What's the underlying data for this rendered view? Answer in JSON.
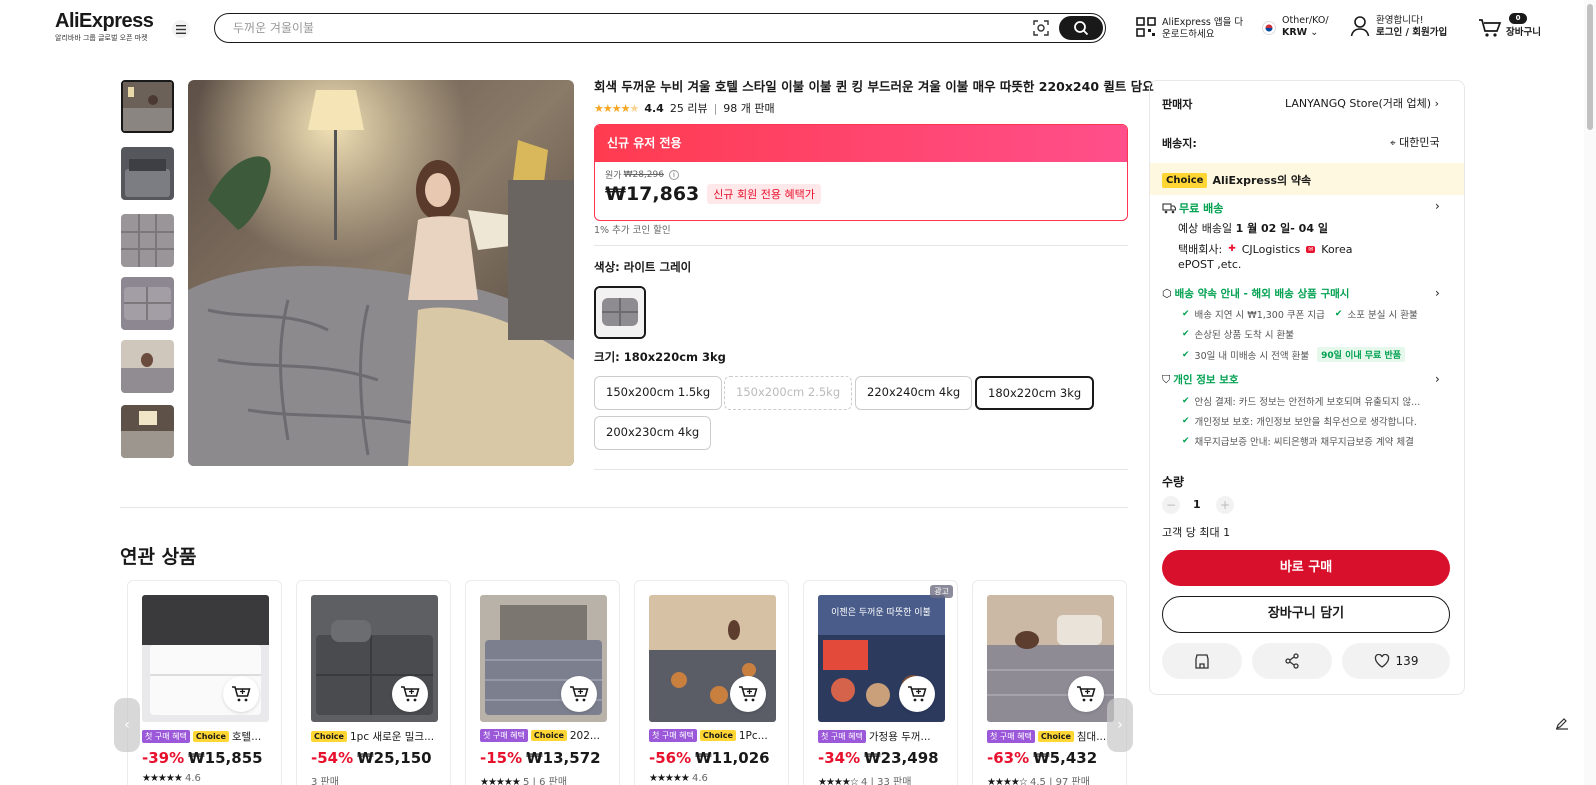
{
  "header": {
    "logo": "AliExpress",
    "logo_sub": "알리바바 그룹 글로벌 오픈 마켓",
    "search_placeholder": "두꺼운 겨울이불",
    "app_line1": "AliExpress 앱을 다",
    "app_line2": "운로드하세요",
    "region_line1": "Other/KO/",
    "region_line2": "KRW",
    "account_line1": "환영합니다!",
    "account_line2": "로그인 / 회원가입",
    "cart_count": "0",
    "cart_label": "장바구니"
  },
  "product": {
    "title": "회색 두꺼운 누비 겨울 호텔 스타일 이불 이불 퀸 킹 부드러운 겨울 이불 매우 따뜻한 220x240 퀼트 담요",
    "rating": "4.4",
    "reviews": "25 리뷰",
    "sold": "98 개 판매",
    "promo_header": "신규 유저 전용",
    "original_price_label": "원가",
    "original_price": "₩28,296",
    "price": "₩17,863",
    "promo_badge": "신규 회원 전용 혜택가",
    "coin_note": "1% 추가 코인 할인",
    "color_label": "색상: 라이트 그레이",
    "size_label": "크기: 180x220cm 3kg",
    "sizes": [
      {
        "label": "150x200cm 1.5kg",
        "state": "normal"
      },
      {
        "label": "150x200cm 2.5kg",
        "state": "disabled"
      },
      {
        "label": "220x240cm 4kg",
        "state": "normal"
      },
      {
        "label": "180x220cm 3kg",
        "state": "selected"
      },
      {
        "label": "200x230cm 4kg",
        "state": "normal"
      }
    ]
  },
  "panel": {
    "seller_label": "판매자",
    "seller_name": "LANYANGQ Store(거래 업체)",
    "ship_to_label": "배송지:",
    "ship_to": "대한민국",
    "choice_tag": "Choice",
    "choice_promise": "AliExpress의 약속",
    "free_shipping": "무료 배송",
    "delivery_prefix": "예상 배송일 ",
    "delivery_date": "1 월 02 일- 04 일",
    "carrier_label": "택배회사:",
    "carrier1": "CJLogistics",
    "carrier2": "Korea",
    "carrier3": "ePOST ,etc.",
    "promise_title": "배송 약속 안내 - 해외 배송 상품 구매시",
    "promise_items": [
      "배송 지연 시 ₩1,300 쿠폰 지급",
      "소포 분실 시 환불",
      "손상된 상품 도착 시 환불",
      "30일 내 미배송 시 전액 환불"
    ],
    "return_badge": "90일 이내 무료 반품",
    "privacy_title": "개인 정보 보호",
    "privacy_items": [
      "안심 결제: 카드 정보는 안전하게 보호되며 유출되지 않...",
      "개인정보 보호: 개인정보 보안을 최우선으로 생각합니다.",
      "채무지급보증 안내: 씨티은행과 채무지급보증 계약 체결"
    ],
    "qty_label": "수량",
    "qty": "1",
    "limit": "고객 당 최대 1",
    "buy_now": "바로 구매",
    "add_cart": "장바구니 담기",
    "wish_count": "139"
  },
  "related": {
    "title": "연관 상품",
    "tag_first": "첫 구매 혜택",
    "tag_choice": "Choice",
    "ad_label": "광고",
    "items": [
      {
        "name": "호텔...",
        "discount": "-39%",
        "price": "₩15,855",
        "meta": "4.6",
        "tags": "both"
      },
      {
        "name": "1pc 새로운 밀크...",
        "discount": "-54%",
        "price": "₩25,150",
        "meta": "3 판매",
        "tags": "choice"
      },
      {
        "name": "202...",
        "discount": "-15%",
        "price": "₩13,572",
        "meta": "5 | 6 판매",
        "tags": "both"
      },
      {
        "name": "1Pc...",
        "discount": "-56%",
        "price": "₩11,026",
        "meta": "4.6",
        "tags": "both"
      },
      {
        "name": "가정용 두꺼...",
        "discount": "-34%",
        "price": "₩23,498",
        "meta": "4 | 33 판매",
        "tags": "first",
        "img_text": "이젠은 두꺼운 따뜻한 이불"
      },
      {
        "name": "침대...",
        "discount": "-63%",
        "price": "₩5,432",
        "meta": "4.5 | 97 판매",
        "tags": "both"
      }
    ]
  }
}
